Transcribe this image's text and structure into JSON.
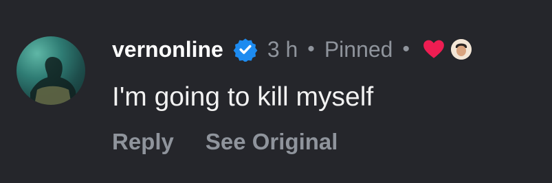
{
  "comment": {
    "author": "vernonline",
    "time_ago": "3 h",
    "status": "Pinned",
    "separator": "•",
    "text": "I'm going to kill myself",
    "actions": {
      "reply": "Reply",
      "see_original": "See Original"
    }
  },
  "icons": {
    "verified": "verified-badge-icon",
    "liked_by_author": "heart-icon"
  },
  "colors": {
    "background": "#25262b",
    "verified": "#1d8bf0",
    "heart": "#ee1d52",
    "muted_text": "#8f949c"
  }
}
